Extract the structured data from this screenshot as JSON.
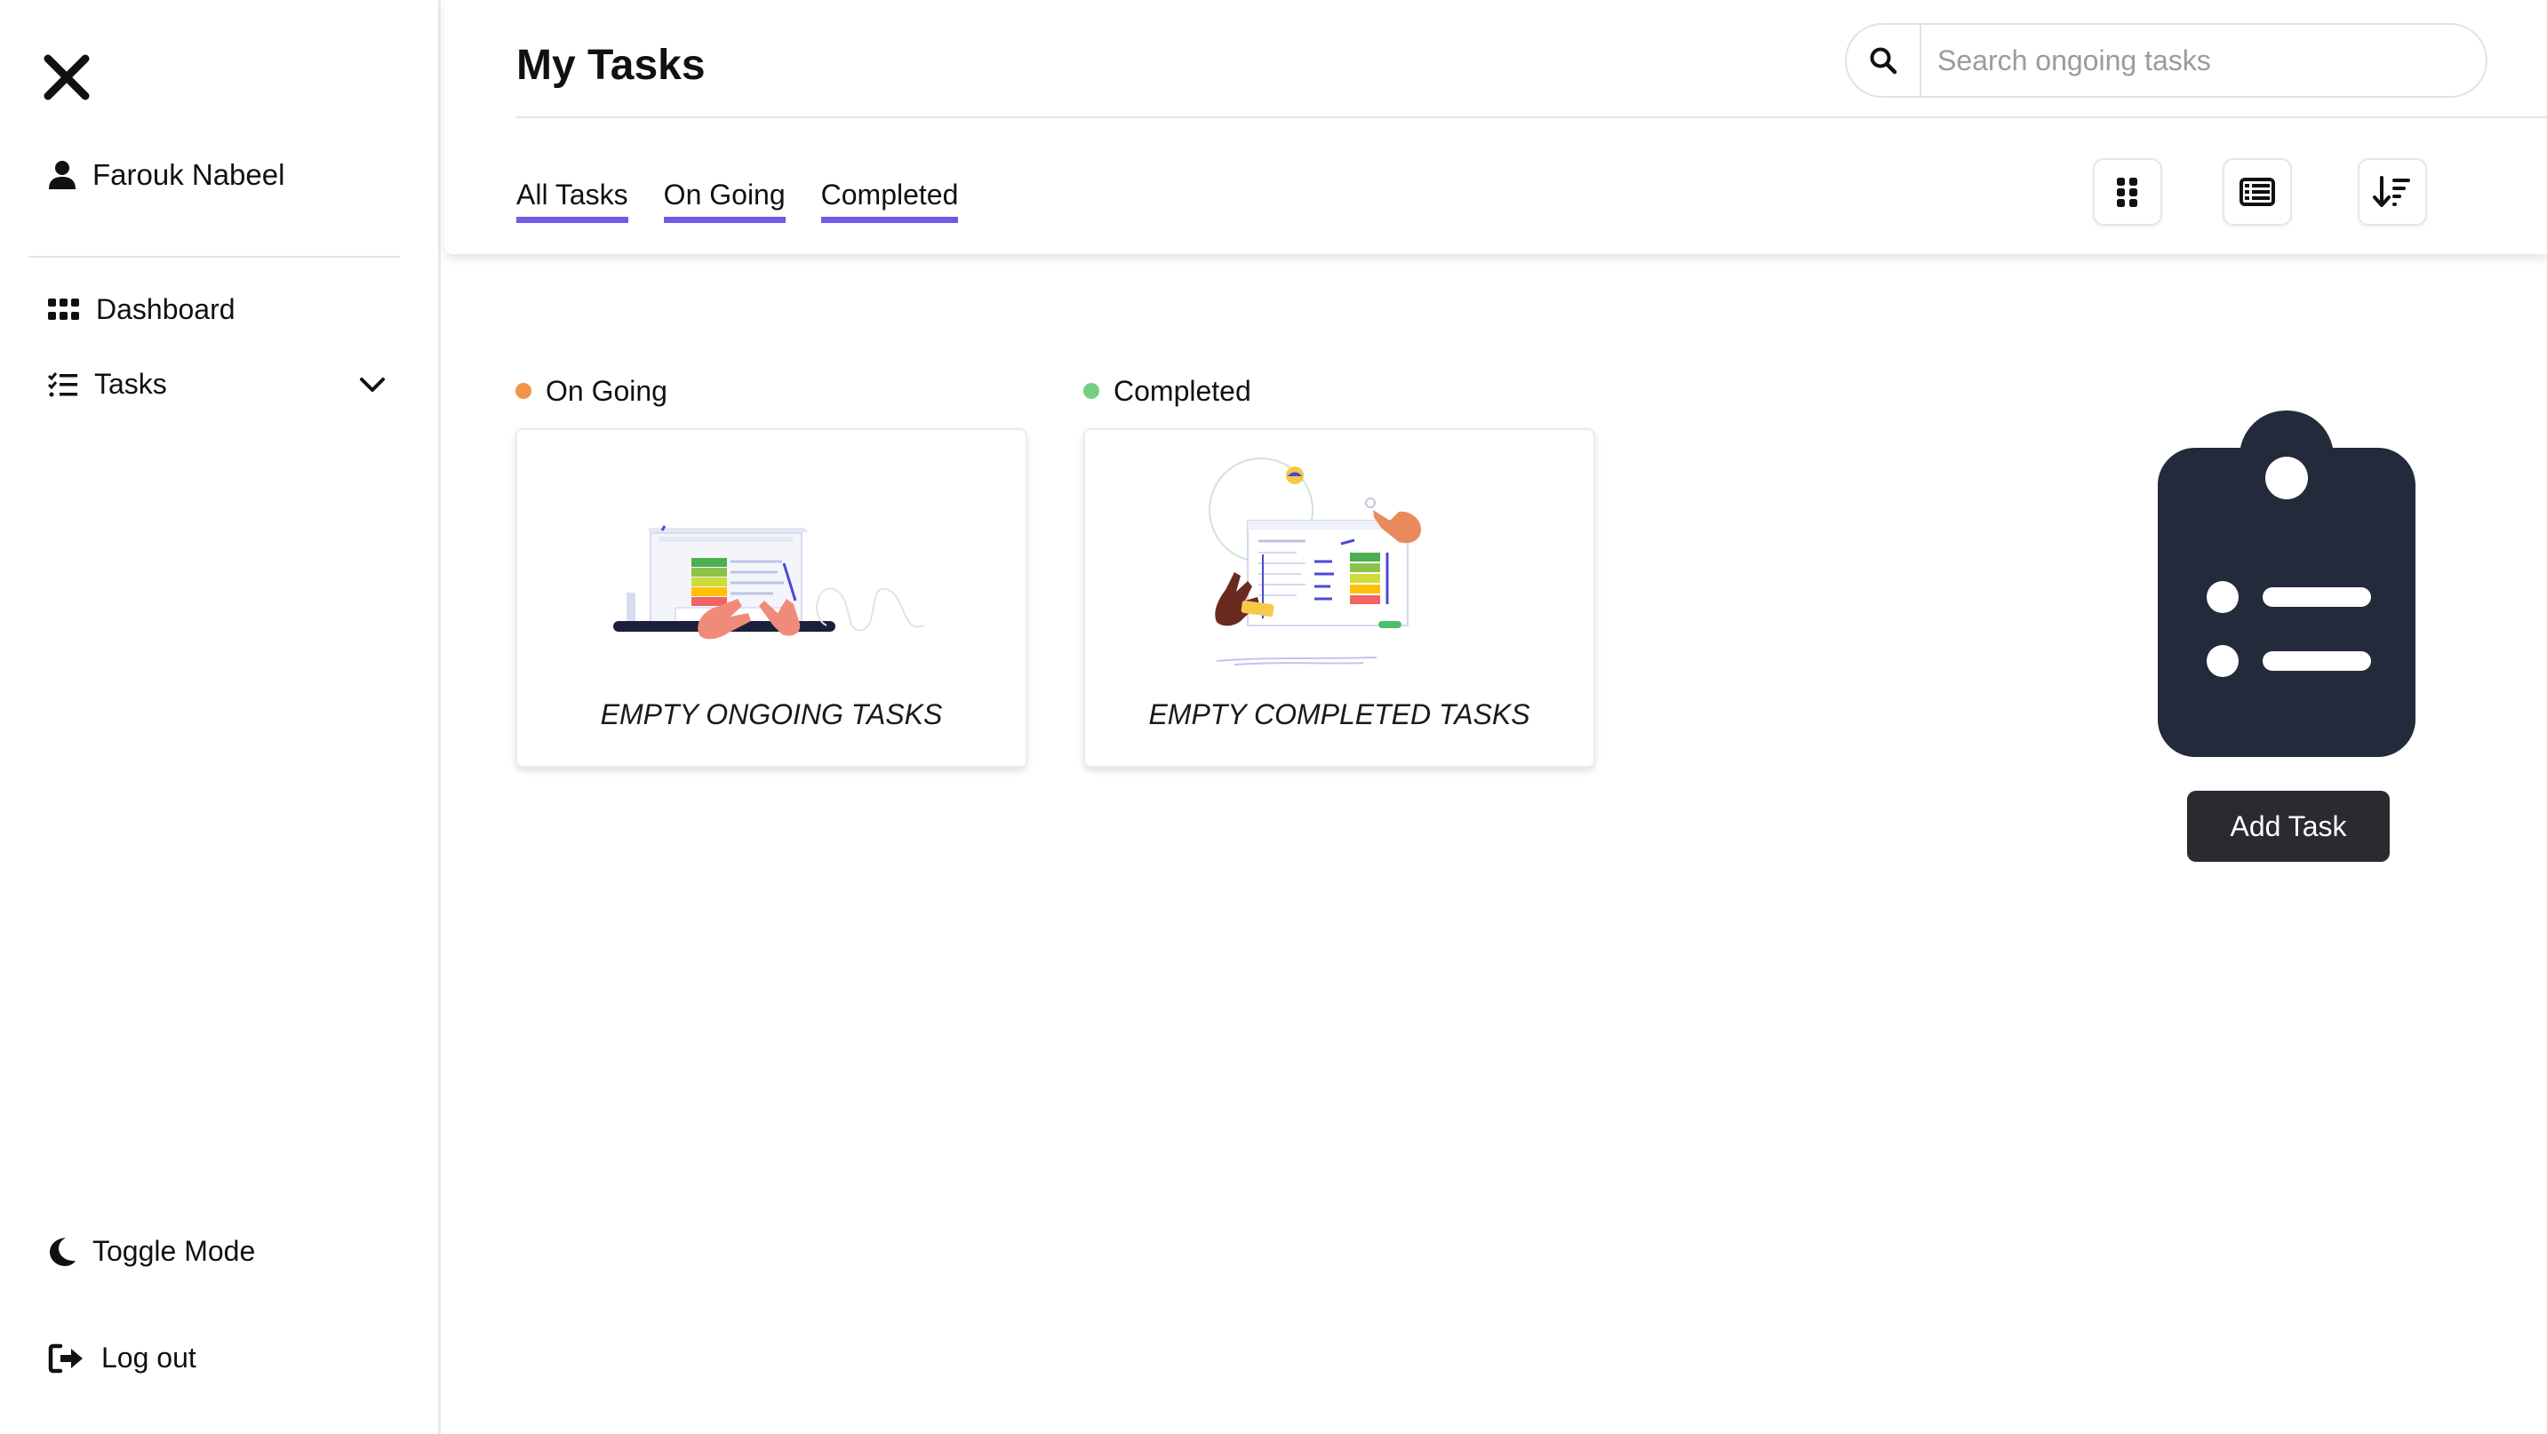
{
  "sidebar": {
    "user_name": "Farouk Nabeel",
    "items": [
      {
        "label": "Dashboard",
        "icon": "dashboard-icon"
      },
      {
        "label": "Tasks",
        "icon": "tasks-icon"
      }
    ],
    "toggle_label": "Toggle Mode",
    "logout_label": "Log out"
  },
  "header": {
    "title": "My Tasks",
    "search_placeholder": "Search ongoing tasks",
    "tabs": [
      {
        "label": "All Tasks"
      },
      {
        "label": "On Going"
      },
      {
        "label": "Completed"
      }
    ],
    "view_buttons": [
      "grid-view-icon",
      "list-view-icon",
      "sort-icon"
    ]
  },
  "columns": [
    {
      "label": "On Going",
      "dot_color": "#f0954a",
      "empty_text": "EMPTY ONGOING TASKS"
    },
    {
      "label": "Completed",
      "dot_color": "#74d07e",
      "empty_text": "EMPTY COMPLETED TASKS"
    }
  ],
  "add_task_label": "Add Task",
  "colors": {
    "accent": "#6c5ce7",
    "dark": "#222a3b",
    "button_dark": "#2a2a30"
  }
}
